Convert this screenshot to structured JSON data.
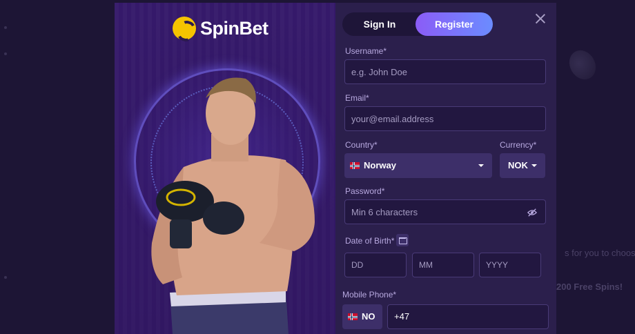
{
  "background": {
    "promo_text1": "s for you to choose",
    "promo_text2": "200 Free Spins!"
  },
  "brand": {
    "name": "SpinBet",
    "accent": "#f5c400"
  },
  "tabs": {
    "signin_label": "Sign In",
    "register_label": "Register",
    "active": "Register"
  },
  "form": {
    "username": {
      "label": "Username*",
      "placeholder": "e.g. John Doe"
    },
    "email": {
      "label": "Email*",
      "placeholder": "your@email.address"
    },
    "country": {
      "label": "Country*",
      "value": "Norway",
      "flag": "norway-flag-icon"
    },
    "currency": {
      "label": "Currency*",
      "value": "NOK"
    },
    "password": {
      "label": "Password*",
      "placeholder": "Min 6 characters"
    },
    "dob": {
      "label": "Date of Birth*",
      "day_placeholder": "DD",
      "month_placeholder": "MM",
      "year_placeholder": "YYYY"
    },
    "phone": {
      "label": "Mobile Phone*",
      "country_code": "NO",
      "prefix": "+47"
    }
  },
  "colors": {
    "register_gradient_start": "#8b5cf6",
    "register_gradient_end": "#6b8cff",
    "label": "#b8a9e0"
  }
}
